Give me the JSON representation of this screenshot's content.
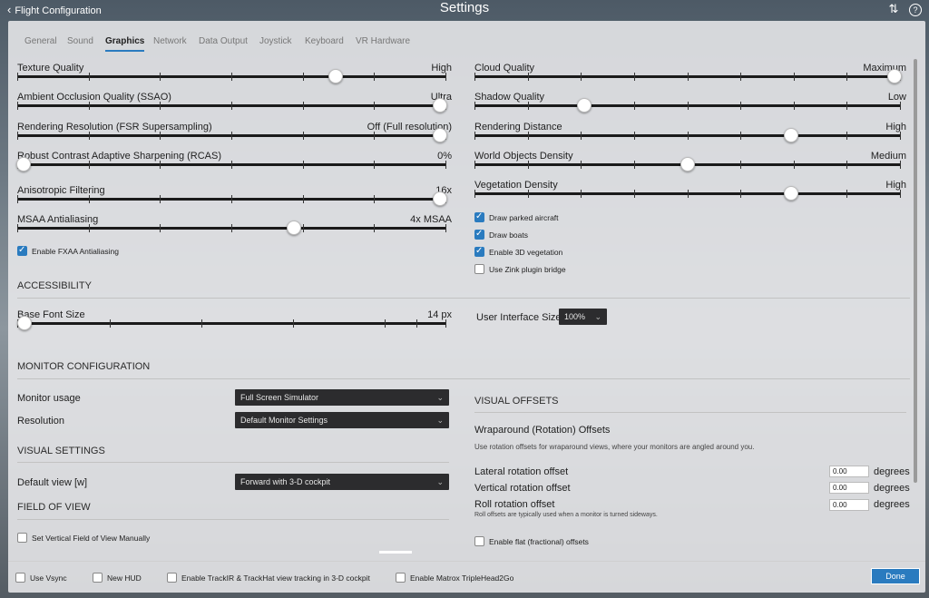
{
  "window": {
    "back_label": "Flight Configuration",
    "title": "Settings"
  },
  "icons": {
    "back": "chevron-left-icon",
    "adjust": "sliders-icon",
    "help": "help-icon"
  },
  "tabs": [
    "General",
    "Sound",
    "Graphics",
    "Network",
    "Data Output",
    "Joystick",
    "Keyboard",
    "VR Hardware"
  ],
  "active_tab": "Graphics",
  "left_sliders": [
    {
      "label": "Texture Quality",
      "value": "High",
      "level": 0.75
    },
    {
      "label": "Ambient Occlusion Quality (SSAO)",
      "value": "Ultra",
      "level": 1.0
    },
    {
      "label": "Rendering Resolution (FSR Supersampling)",
      "value": "Off (Full resolution)",
      "level": 1.0
    },
    {
      "label": "Robust Contrast Adaptive Sharpening (RCAS)",
      "value": "0%",
      "level": 0.0
    },
    {
      "label": "Anisotropic Filtering",
      "value": "16x",
      "level": 1.0
    },
    {
      "label": "MSAA Antialiasing",
      "value": "4x MSAA",
      "level": 0.65
    }
  ],
  "fxaa": {
    "label": "Enable FXAA Antialiasing",
    "checked": true
  },
  "right_sliders": [
    {
      "label": "Cloud Quality",
      "value": "Maximum",
      "level": 1.0
    },
    {
      "label": "Shadow Quality",
      "value": "Low",
      "level": 0.25
    },
    {
      "label": "Rendering Distance",
      "value": "High",
      "level": 0.75
    },
    {
      "label": "World Objects Density",
      "value": "Medium",
      "level": 0.5
    },
    {
      "label": "Vegetation Density",
      "value": "High",
      "level": 0.75
    }
  ],
  "right_checks": [
    {
      "label": "Draw parked aircraft",
      "checked": true
    },
    {
      "label": "Draw boats",
      "checked": true
    },
    {
      "label": "Enable 3D vegetation",
      "checked": true
    },
    {
      "label": "Use Zink plugin bridge",
      "checked": false
    }
  ],
  "accessibility": {
    "heading": "ACCESSIBILITY",
    "font_label": "Base Font Size",
    "font_value": "14 px",
    "font_level": 0.0,
    "ui_size_label": "User Interface Size",
    "ui_size_value": "100%"
  },
  "monitor": {
    "heading": "MONITOR CONFIGURATION",
    "usage_label": "Monitor usage",
    "usage_value": "Full Screen Simulator",
    "resolution_label": "Resolution",
    "resolution_value": "Default Monitor Settings"
  },
  "visual_settings": {
    "heading": "VISUAL SETTINGS",
    "default_view_label": "Default view [w]",
    "default_view_value": "Forward with 3-D cockpit"
  },
  "fov": {
    "heading": "FIELD OF VIEW",
    "set_vertical": {
      "label": "Set Vertical Field of View Manually",
      "checked": false
    }
  },
  "visual_offsets": {
    "heading": "VISUAL OFFSETS",
    "subheading": "Wraparound (Rotation) Offsets",
    "description": "Use rotation offsets for wraparound views, where your monitors are angled around you.",
    "rows": [
      {
        "label": "Lateral rotation offset",
        "value": "0.00",
        "unit": "degrees"
      },
      {
        "label": "Vertical rotation offset",
        "value": "0.00",
        "unit": "degrees"
      },
      {
        "label": "Roll rotation offset",
        "value": "0.00",
        "unit": "degrees"
      }
    ],
    "roll_note": "Roll offsets are typically used when a monitor is turned sideways.",
    "flat_offsets": {
      "label": "Enable flat (fractional) offsets",
      "checked": false
    }
  },
  "bottom_checks": [
    {
      "label": "Use Vsync",
      "checked": false
    },
    {
      "label": "New HUD",
      "checked": false
    },
    {
      "label": "Enable TrackIR & TrackHat view tracking in 3-D cockpit",
      "checked": false
    },
    {
      "label": "Enable Matrox TripleHead2Go",
      "checked": false
    }
  ],
  "done_label": "Done",
  "colors": {
    "accent": "#2a7bbf",
    "panel": "#e8e8ea",
    "track": "#1a1a1a",
    "dropdown": "#2c2c2e"
  }
}
